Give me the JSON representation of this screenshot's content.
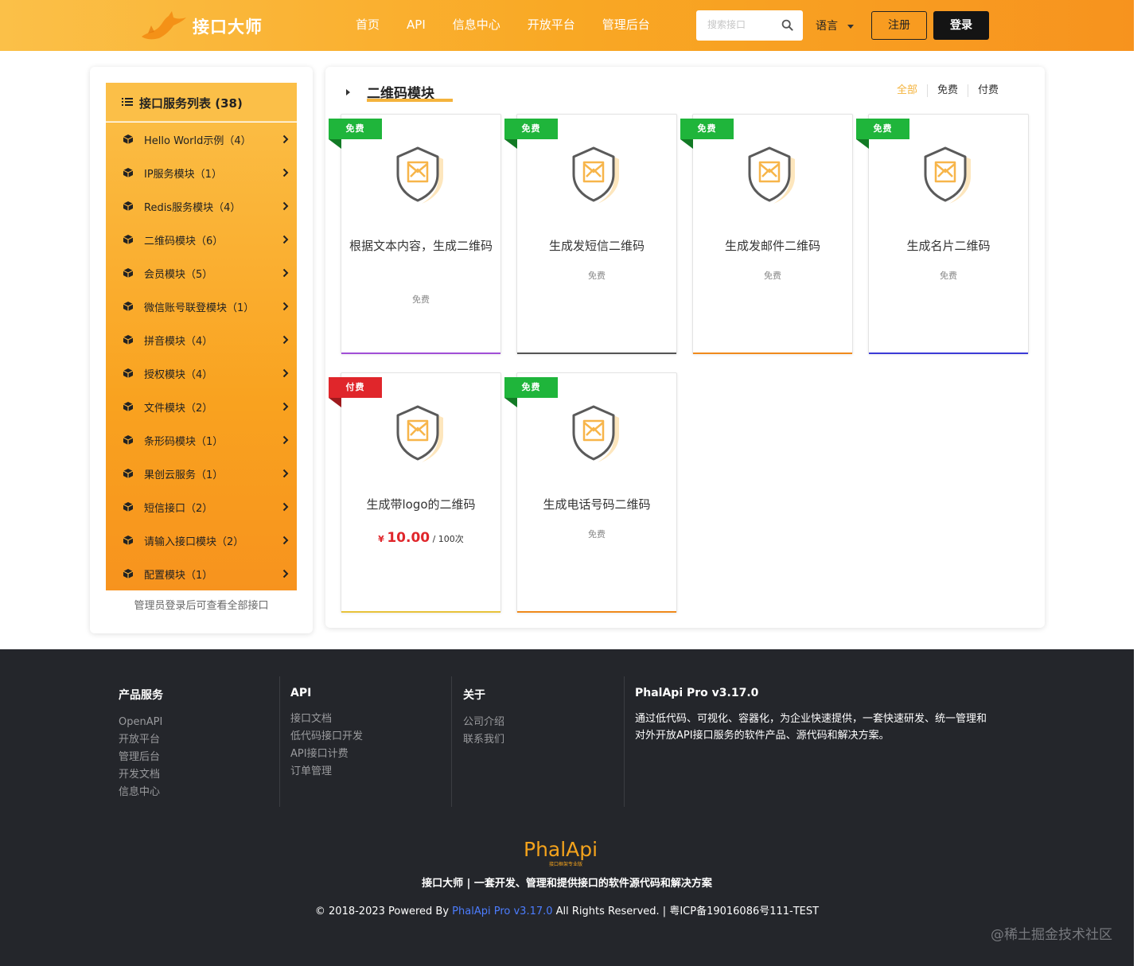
{
  "header": {
    "brand": "接口大师",
    "nav": [
      "首页",
      "API",
      "信息中心",
      "开放平台",
      "管理后台"
    ],
    "search_placeholder": "搜索接口",
    "lang": "语言",
    "register": "注册",
    "login": "登录"
  },
  "sidebar": {
    "title": "接口服务列表 (38)",
    "items": [
      {
        "label": "Hello World示例（4）"
      },
      {
        "label": "IP服务模块（1）"
      },
      {
        "label": "Redis服务模块（4）"
      },
      {
        "label": "二维码模块（6）"
      },
      {
        "label": "会员模块（5）"
      },
      {
        "label": "微信账号联登模块（1）"
      },
      {
        "label": "拼音模块（4）"
      },
      {
        "label": "授权模块（4）"
      },
      {
        "label": "文件模块（2）"
      },
      {
        "label": "条形码模块（1）"
      },
      {
        "label": "果创云服务（1）"
      },
      {
        "label": "短信接口（2）"
      },
      {
        "label": "请输入接口模块（2）"
      },
      {
        "label": "配置模块（1）"
      }
    ],
    "note": "管理员登录后可查看全部接口"
  },
  "main": {
    "title": "二维码模块",
    "filters": [
      "全部",
      "免费",
      "付费"
    ],
    "cards": [
      {
        "badge": "免费",
        "type": "free",
        "name": "根据文本内容，生成二维码",
        "price": "免费",
        "accent": "#a04fd6"
      },
      {
        "badge": "免费",
        "type": "free",
        "name": "生成发短信二维码",
        "price": "免费",
        "accent": "#555555"
      },
      {
        "badge": "免费",
        "type": "free",
        "name": "生成发邮件二维码",
        "price": "免费",
        "accent": "#f08a1c"
      },
      {
        "badge": "免费",
        "type": "free",
        "name": "生成名片二维码",
        "price": "免费",
        "accent": "#3b3ad6"
      },
      {
        "badge": "付费",
        "type": "paid",
        "name": "生成带logo的二维码",
        "price_currency": "¥",
        "price_value": "10.00",
        "price_unit": "/ 100次",
        "accent": "#e8c23a"
      },
      {
        "badge": "免费",
        "type": "free",
        "name": "生成电话号码二维码",
        "price": "免费",
        "accent": "#f08a1c"
      }
    ]
  },
  "footer": {
    "columns": [
      {
        "title": "产品服务",
        "links": [
          "OpenAPI",
          "开放平台",
          "管理后台",
          "开发文档",
          "信息中心"
        ]
      },
      {
        "title": "API",
        "links": [
          "接口文档",
          "低代码接口开发",
          "API接口计费",
          "订单管理"
        ]
      },
      {
        "title": "关于",
        "links": [
          "公司介绍",
          "联系我们"
        ]
      },
      {
        "title": "PhalApi Pro v3.17.0",
        "text": [
          "通过低代码、可视化、容器化，为企业快速提供，一套快速研发、统一管理和",
          "对外开放API接口服务的软件产品、源代码和解决方案。"
        ]
      }
    ],
    "logo_text": "PhalApi",
    "logo_sub": "接口框架专业版",
    "tagline": "接口大师 | 一套开发、管理和提供接口的软件源代码和解决方案",
    "copy_prefix": "© 2018-2023 Powered By ",
    "copy_link": "PhalApi Pro v3.17.0",
    "copy_suffix": " All Rights Reserved. |  粤ICP备19016086号111-TEST"
  },
  "watermark": "@稀土掘金技术社区",
  "colors": {
    "brand_orange": "#f9a824",
    "free_green": "#1fb53b",
    "paid_red": "#e0262b",
    "footer_bg": "#24262b",
    "accent_yellow": "#f4b33c"
  },
  "icons": {
    "search": "search-icon",
    "cube": "cube-icon",
    "chevron": "chevron-right-icon",
    "shield": "shield-icon",
    "list": "list-icon"
  }
}
